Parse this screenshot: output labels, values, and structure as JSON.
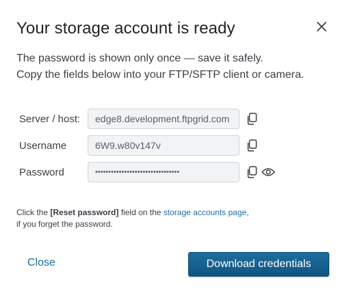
{
  "dialog": {
    "title": "Your storage account is ready",
    "intro_line1": "The password is shown only once — save it safely.",
    "intro_line2": "Copy the fields below into your FTP/SFTP client or camera."
  },
  "fields": {
    "server_label": "Server / host:",
    "server_value": "edge8.development.ftpgrid.com",
    "username_label": "Username",
    "username_value": "6W9.w80v147v",
    "password_label": "Password",
    "password_masked": "••••••••••••••••••••••••••••••••"
  },
  "note": {
    "prefix": "Click the ",
    "reset_field": "[Reset password]",
    "middle": " field on the ",
    "link_text": "storage accounts page",
    "suffix": ",",
    "line2": "if you forget the password."
  },
  "actions": {
    "close_label": "Close",
    "download_label": "Download credentials"
  },
  "icons": {
    "close": "close-icon",
    "copy": "copy-icon",
    "show_password": "eye-icon"
  },
  "colors": {
    "accent": "#1a6fa0",
    "button_bg": "#15608f",
    "field_bg": "#f1f3f5"
  }
}
